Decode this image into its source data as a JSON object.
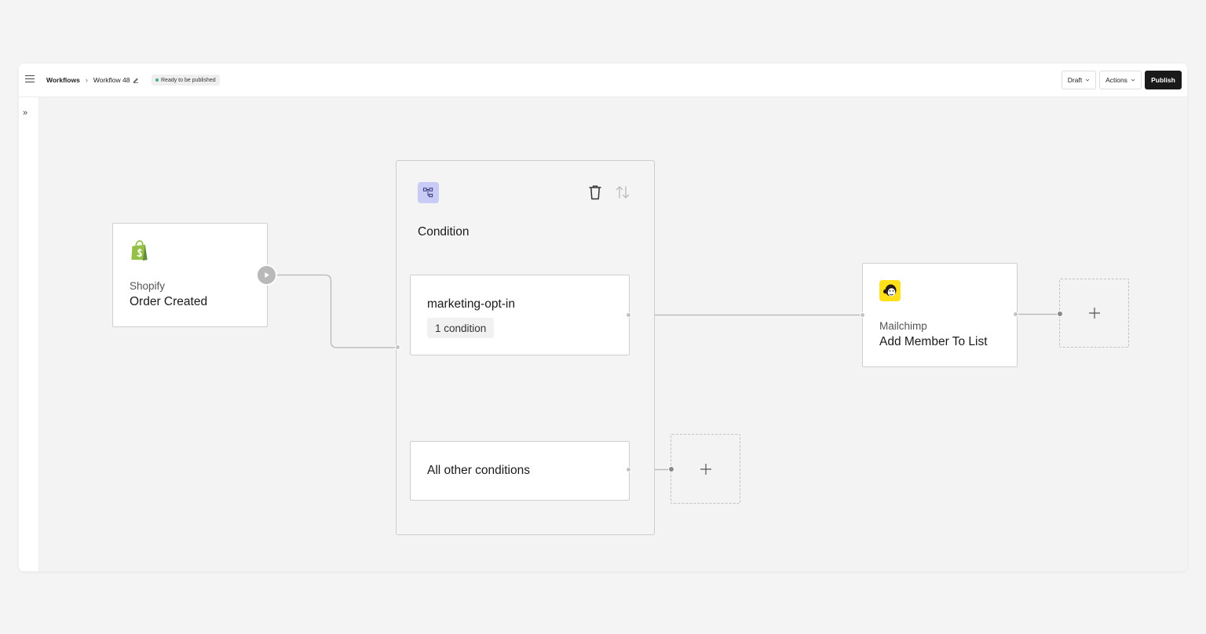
{
  "header": {
    "breadcrumb_root": "Workflows",
    "breadcrumb_separator": "›",
    "workflow_name": "Workflow 48",
    "status": "Ready to be published",
    "draft_label": "Draft",
    "actions_label": "Actions",
    "publish_label": "Publish"
  },
  "sidebar": {
    "toggle_label": "»"
  },
  "trigger": {
    "app": "Shopify",
    "event": "Order Created",
    "icon": "shopify-icon"
  },
  "condition": {
    "title": "Condition",
    "icon": "branch-icon",
    "branches": [
      {
        "name": "marketing-opt-in",
        "badge": "1 condition"
      },
      {
        "name": "All other conditions"
      }
    ]
  },
  "action": {
    "app": "Mailchimp",
    "event": "Add Member To List",
    "icon": "mailchimp-icon"
  },
  "colors": {
    "status_dot": "#3fb37a",
    "publish_bg": "#1a1a1a",
    "condition_icon_bg": "#c9cbf7",
    "mailchimp_yellow": "#ffe01b",
    "shopify_green": "#95bf47"
  }
}
